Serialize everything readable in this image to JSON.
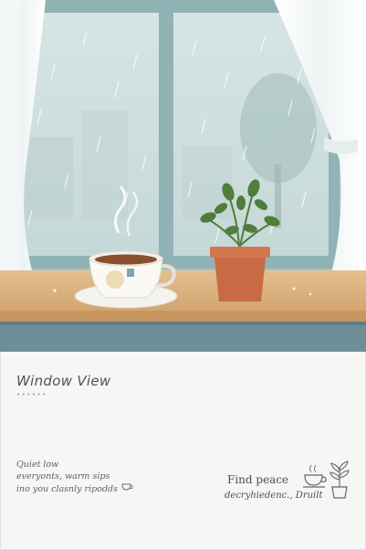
{
  "cover": {
    "title": "Window View",
    "dots": "••••••",
    "blurb_lines": [
      "Quiet low",
      "everyonts, warm sips",
      "ino you clasnly ripodds"
    ],
    "tagline_1": "Find peace",
    "tagline_2": "decryhiedenc., Druilt"
  },
  "colors": {
    "sky": "#cfe0e0",
    "frame": "#8fb2b4",
    "sill": "#d8b07f",
    "band": "#6e8f97",
    "pot": "#c96a44",
    "leaf": "#4f7d3a"
  },
  "icons": [
    "teacup-icon",
    "potted-plant-icon"
  ]
}
